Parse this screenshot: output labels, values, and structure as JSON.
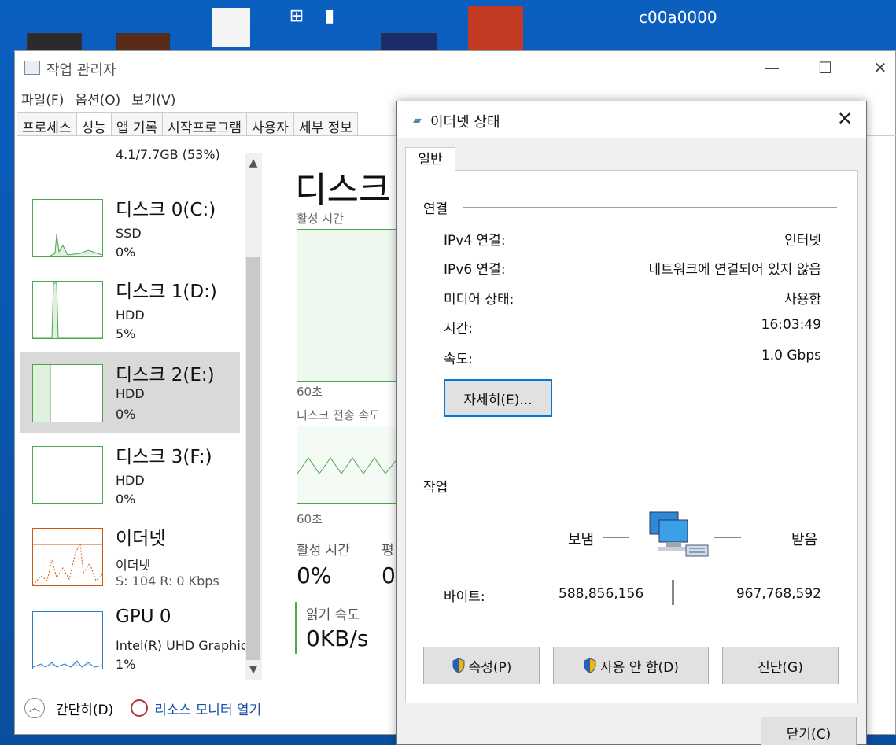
{
  "desktop": {
    "label": "c00a0000"
  },
  "task_manager": {
    "title": "작업 관리자",
    "menu": [
      "파일(F)",
      "옵션(O)",
      "보기(V)"
    ],
    "tabs": [
      "프로세스",
      "성능",
      "앱 기록",
      "시작프로그램",
      "사용자",
      "세부 정보"
    ],
    "active_tab": "성능",
    "sidebar": [
      {
        "name": "",
        "sub": "4.1/7.7GB (53%)",
        "val": ""
      },
      {
        "name": "디스크 0(C:)",
        "sub": "SSD",
        "val": "0%"
      },
      {
        "name": "디스크 1(D:)",
        "sub": "HDD",
        "val": "5%"
      },
      {
        "name": "디스크 2(E:)",
        "sub": "HDD",
        "val": "0%"
      },
      {
        "name": "디스크 3(F:)",
        "sub": "HDD",
        "val": "0%"
      },
      {
        "name": "이더넷",
        "sub": "이더넷",
        "val": "S: 104  R: 0 Kbps"
      },
      {
        "name": "GPU 0",
        "sub": "Intel(R) UHD Graphic",
        "val": "1%"
      }
    ],
    "main": {
      "title": "디스크",
      "active_time_label": "활성 시간",
      "seconds_label": "60초",
      "transfer_label": "디스크 전송 속도",
      "seconds_label2": "60초",
      "active_time_stat_label": "활성 시간",
      "avg_label": "평",
      "active_time_value": "0%",
      "avg_value": "0",
      "read_speed_label": "읽기 속도",
      "read_speed_value": "0KB/s"
    },
    "footer": {
      "collapse_label": "간단히(D)",
      "resource_monitor_label": "리소스 모니터 열기"
    }
  },
  "ethernet_dialog": {
    "title": "이더넷 상태",
    "tab": "일반",
    "connection_group": "연결",
    "rows": [
      {
        "label": "IPv4 연결:",
        "value": "인터넷"
      },
      {
        "label": "IPv6 연결:",
        "value": "네트워크에 연결되어 있지 않음"
      },
      {
        "label": "미디어 상태:",
        "value": "사용함"
      },
      {
        "label": "시간:",
        "value": "16:03:49"
      },
      {
        "label": "속도:",
        "value": "1.0 Gbps"
      }
    ],
    "details_button": "자세히(E)...",
    "activity_group": "작업",
    "sent_label": "보냄",
    "received_label": "받음",
    "bytes_label": "바이트:",
    "bytes_sent": "588,856,156",
    "bytes_received": "967,768,592",
    "properties_button": "속성(P)",
    "disable_button": "사용 안 함(D)",
    "diagnose_button": "진단(G)",
    "close_button": "닫기(C)"
  }
}
